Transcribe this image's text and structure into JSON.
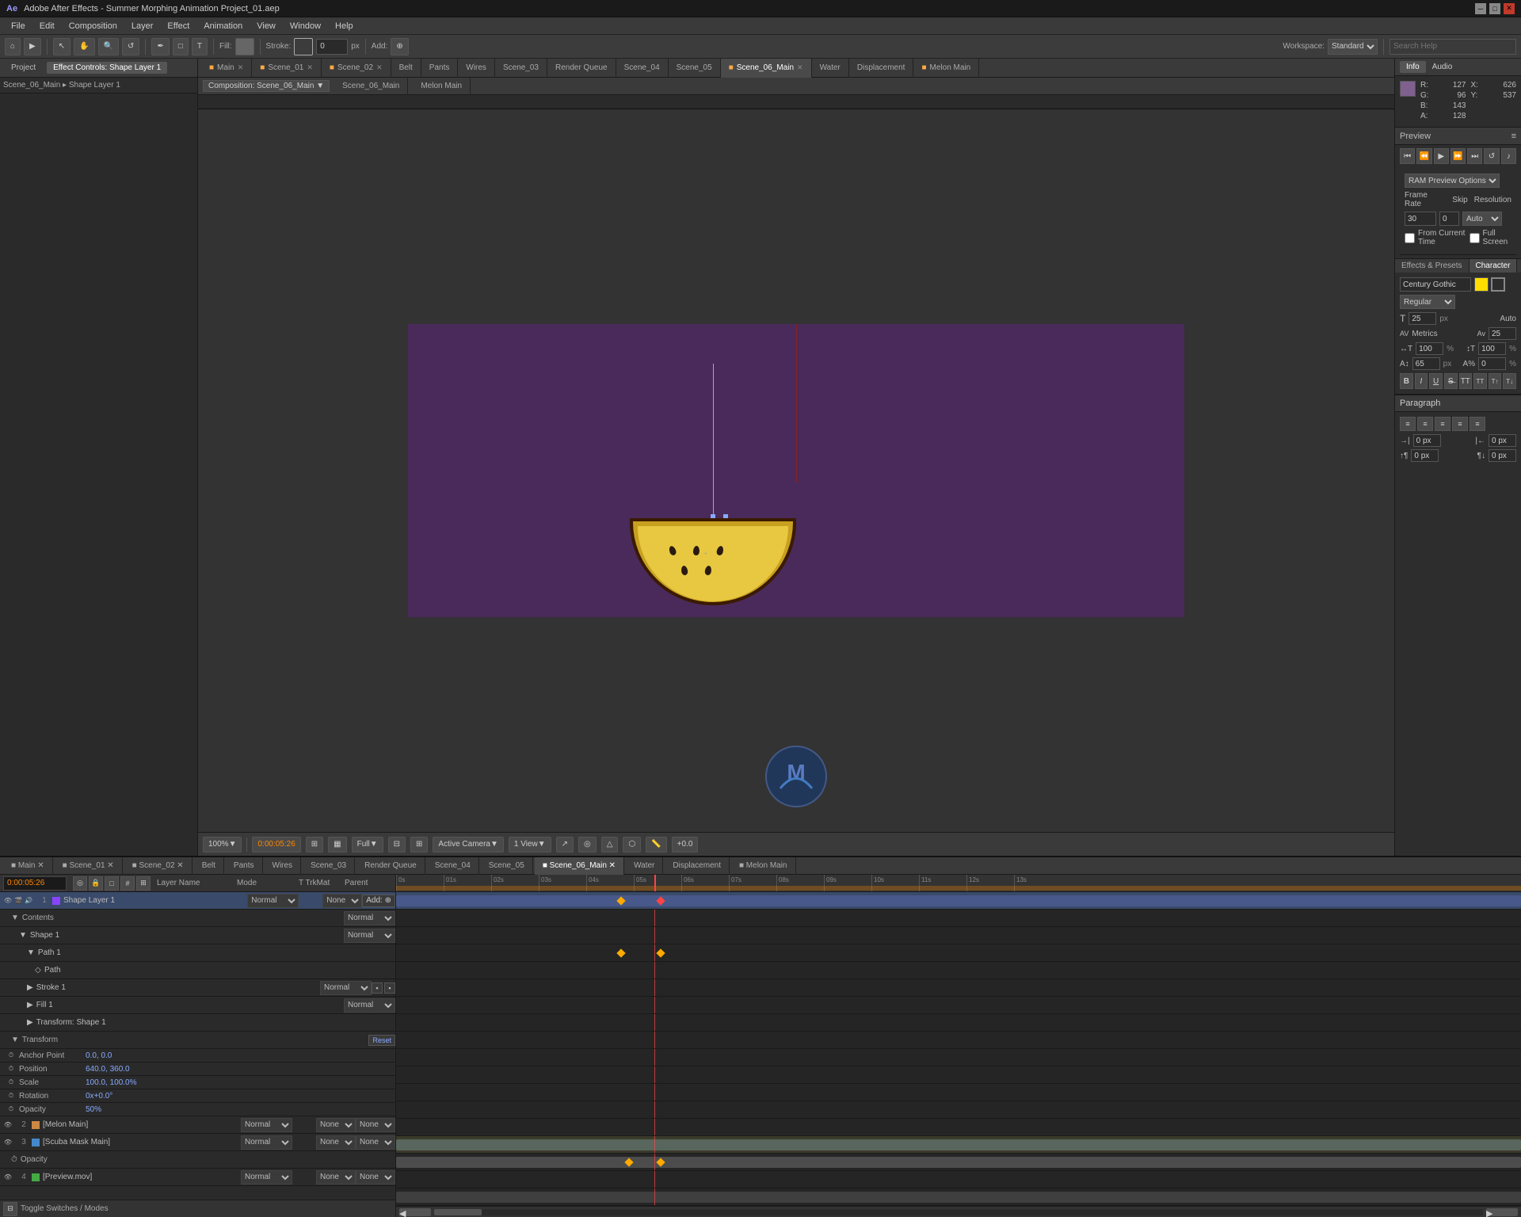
{
  "app": {
    "title": "Adobe After Effects - Summer Morphing Animation Project_01.aep",
    "version": "After Effects"
  },
  "titlebar": {
    "title": "Adobe After Effects - Summer Morphing Animation Project_01.aep",
    "min_label": "─",
    "max_label": "□",
    "close_label": "✕"
  },
  "menubar": {
    "items": [
      "File",
      "Edit",
      "Composition",
      "Layer",
      "Effect",
      "Animation",
      "View",
      "Window",
      "Help"
    ]
  },
  "toolbar": {
    "fill_label": "Fill:",
    "stroke_label": "Stroke:",
    "stroke_value": "0",
    "stroke_unit": "px",
    "add_label": "Add:"
  },
  "left_panel": {
    "tabs": [
      "Project",
      "Effect Controls: Shape Layer 1"
    ],
    "breadcrumb": "Scene_06_Main ▸ Shape Layer 1"
  },
  "composition_tabs": {
    "tabs": [
      {
        "label": "Main",
        "active": false
      },
      {
        "label": "Scene_01",
        "active": false
      },
      {
        "label": "Scene_02",
        "active": false
      },
      {
        "label": "Belt",
        "active": false
      },
      {
        "label": "Pants",
        "active": false
      },
      {
        "label": "Wires",
        "active": false
      },
      {
        "label": "Scene_03",
        "active": false
      },
      {
        "label": "Render Queue",
        "active": false
      },
      {
        "label": "Scene_04",
        "active": false
      },
      {
        "label": "Scene_05",
        "active": false
      },
      {
        "label": "Scene_06_Main",
        "active": true
      },
      {
        "label": "Water",
        "active": false
      },
      {
        "label": "Displacement",
        "active": false
      },
      {
        "label": "Melon Main",
        "active": false
      }
    ],
    "active_comp": "Composition: Scene_06_Main ▼"
  },
  "viewer": {
    "zoom": "100%",
    "time": "0:00:05:26",
    "quality": "Full",
    "camera": "Active Camera",
    "view": "1 View",
    "time_display": "+0.0"
  },
  "info_panel": {
    "title": "Info",
    "audio_tab": "Audio",
    "r_label": "R:",
    "r_value": "127",
    "g_label": "G:",
    "g_value": "96",
    "b_label": "B:",
    "b_value": "143",
    "a_label": "A:",
    "a_value": "128",
    "x_label": "X:",
    "x_value": "626",
    "y_label": "Y:",
    "y_value": "537"
  },
  "preview_panel": {
    "title": "Preview",
    "ram_preview_options": "RAM Preview Options",
    "frame_rate_label": "Frame Rate",
    "frame_rate_value": "30",
    "skip_label": "Skip",
    "skip_value": "0",
    "resolution_label": "Resolution",
    "resolution_value": "Auto",
    "from_current_label": "From Current Time",
    "full_screen_label": "Full Screen"
  },
  "character_panel": {
    "title": "Character",
    "font_name": "Century Gothic",
    "font_style": "Regular",
    "size_value": "25",
    "size_unit": "px",
    "auto_label": "Auto",
    "kern_label": "Metrics",
    "tracking_value": "25",
    "scale_h_value": "100",
    "scale_h_unit": "%",
    "scale_v_value": "100",
    "scale_v_unit": "%",
    "baseline_value": "65",
    "baseline_unit": "px",
    "tsume_value": "0",
    "tsume_unit": "%"
  },
  "paragraph_panel": {
    "title": "Paragraph",
    "indent_before_label": "0 px",
    "indent_after_label": "0 px",
    "space_before_label": "0 px",
    "space_after_label": "0 px"
  },
  "timeline": {
    "current_time": "0:00:05:26",
    "tabs": [
      {
        "label": "Main",
        "active": false
      },
      {
        "label": "Scene_01",
        "active": false
      },
      {
        "label": "Scene_02",
        "active": false
      },
      {
        "label": "Belt",
        "active": false
      },
      {
        "label": "Pants",
        "active": false
      },
      {
        "label": "Wires",
        "active": false
      },
      {
        "label": "Scene_03",
        "active": false
      },
      {
        "label": "Render Queue",
        "active": false
      },
      {
        "label": "Scene_04",
        "active": false
      },
      {
        "label": "Scene_05",
        "active": false
      },
      {
        "label": "Scene_06_Main",
        "active": true
      },
      {
        "label": "Water",
        "active": false
      },
      {
        "label": "Displacement",
        "active": false
      },
      {
        "label": "Melon Main",
        "active": false
      }
    ],
    "header_cols": [
      "Layer Name",
      "Mode",
      "T TrkMat",
      "Parent"
    ],
    "layers": [
      {
        "num": "1",
        "name": "Shape Layer 1",
        "mode": "Normal",
        "parent": "None",
        "selected": true,
        "type": "shape"
      },
      {
        "num": "",
        "name": "Contents",
        "mode": "",
        "parent": "",
        "sub": 1,
        "type": "group"
      },
      {
        "num": "",
        "name": "Shape 1",
        "mode": "Normal",
        "parent": "",
        "sub": 2,
        "type": "group"
      },
      {
        "num": "",
        "name": "Path 1",
        "mode": "",
        "parent": "",
        "sub": 3,
        "type": "path"
      },
      {
        "num": "",
        "name": "Path",
        "mode": "",
        "parent": "",
        "sub": 4,
        "type": "property"
      },
      {
        "num": "",
        "name": "Stroke 1",
        "mode": "Normal",
        "parent": "",
        "sub": 3,
        "type": "stroke"
      },
      {
        "num": "",
        "name": "Fill 1",
        "mode": "Normal",
        "parent": "",
        "sub": 3,
        "type": "fill"
      },
      {
        "num": "",
        "name": "Transform: Shape 1",
        "mode": "",
        "parent": "",
        "sub": 3,
        "type": "transform"
      },
      {
        "num": "",
        "name": "Transform",
        "mode": "",
        "parent": "",
        "sub": 1,
        "type": "transform_group"
      },
      {
        "num": "",
        "name": "Anchor Point",
        "mode": "",
        "parent": "0.0, 0.0",
        "sub": 2,
        "type": "property"
      },
      {
        "num": "",
        "name": "Position",
        "mode": "",
        "parent": "640.0, 360.0",
        "sub": 2,
        "type": "property"
      },
      {
        "num": "",
        "name": "Scale",
        "mode": "",
        "parent": "100.0, 100.0%",
        "sub": 2,
        "type": "property"
      },
      {
        "num": "",
        "name": "Rotation",
        "mode": "",
        "parent": "0x+0.0°",
        "sub": 2,
        "type": "property"
      },
      {
        "num": "",
        "name": "Opacity",
        "mode": "",
        "parent": "50%",
        "sub": 2,
        "type": "property"
      },
      {
        "num": "2",
        "name": "[Melon Main]",
        "mode": "Normal",
        "parent": "None",
        "sub": 0,
        "type": "precomp"
      },
      {
        "num": "3",
        "name": "[Scuba Mask Main]",
        "mode": "Normal",
        "parent": "None",
        "sub": 0,
        "type": "precomp"
      },
      {
        "num": "",
        "name": "Opacity",
        "mode": "",
        "parent": "",
        "sub": 1,
        "type": "property"
      },
      {
        "num": "4",
        "name": "[Preview.mov]",
        "mode": "Normal",
        "parent": "None",
        "sub": 0,
        "type": "video"
      }
    ],
    "time_markers": [
      "0s",
      "01s",
      "02s",
      "03s",
      "04s",
      "05s",
      "06s",
      "07s",
      "08s",
      "09s",
      "10s",
      "11s",
      "12s",
      "13s"
    ]
  }
}
